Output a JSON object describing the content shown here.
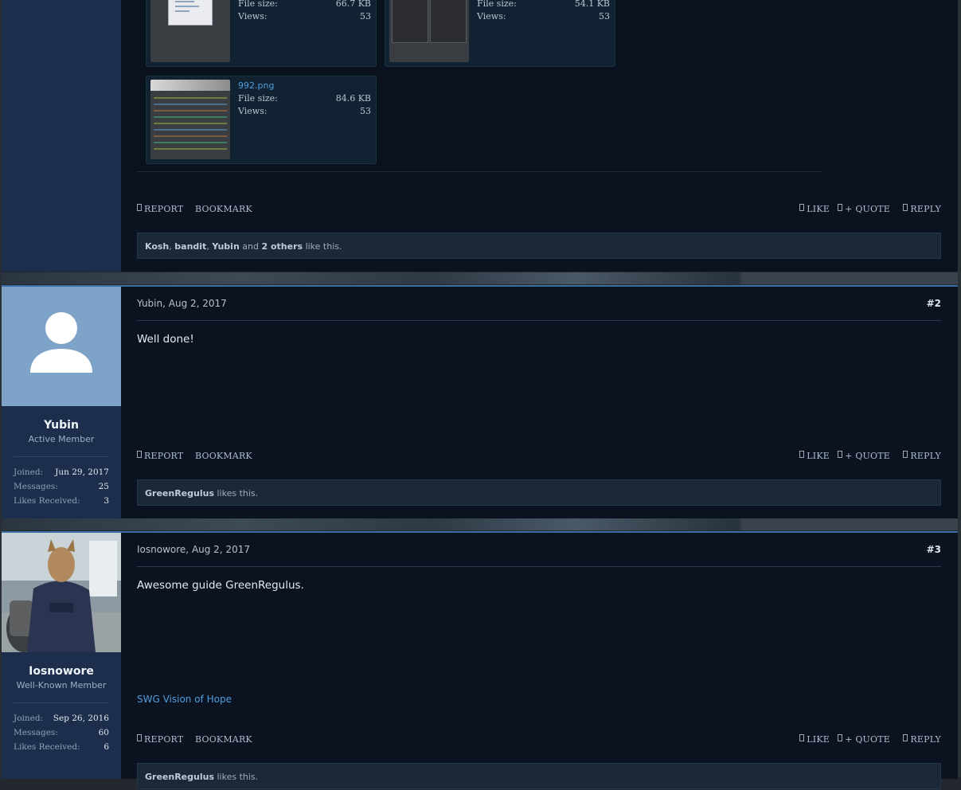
{
  "attachments": [
    {
      "name": "",
      "size_label": "File size:",
      "size": "66.7 KB",
      "views_label": "Views:",
      "views": "53"
    },
    {
      "name": "",
      "size_label": "File size:",
      "size": "54.1 KB",
      "views_label": "Views:",
      "views": "53"
    },
    {
      "name": "992.png",
      "size_label": "File size:",
      "size": "84.6 KB",
      "views_label": "Views:",
      "views": "53"
    }
  ],
  "actions": {
    "report": "REPORT",
    "bookmark": "BOOKMARK",
    "like": "LIKE",
    "quote": "+ QUOTE",
    "reply": "REPLY"
  },
  "posts": [
    {
      "likes": {
        "u1": "Kosh",
        "u2": "bandit",
        "u3": "Yubin",
        "and": "and",
        "others": "2 others",
        "suffix": "like this."
      }
    },
    {
      "author": "Yubin",
      "date": "Aug 2, 2017",
      "number": "#2",
      "body": "Well done!",
      "title": "Active Member",
      "stats": {
        "joined_label": "Joined:",
        "joined": "Jun 29, 2017",
        "messages_label": "Messages:",
        "messages": "25",
        "likes_label": "Likes Received:",
        "likes": "3"
      },
      "likes": {
        "u1": "GreenRegulus",
        "suffix": "likes this."
      }
    },
    {
      "author": "Iosnowore",
      "date": "Aug 2, 2017",
      "number": "#3",
      "body": "Awesome guide GreenRegulus.",
      "signature": "SWG Vision of Hope",
      "title": "Well-Known Member",
      "stats": {
        "joined_label": "Joined:",
        "joined": "Sep 26, 2016",
        "messages_label": "Messages:",
        "messages": "60",
        "likes_label": "Likes Received:",
        "likes": "6"
      },
      "likes": {
        "u1": "GreenRegulus",
        "suffix": "likes this."
      }
    }
  ],
  "colors": {
    "accent": "#3a6ea5",
    "link": "#4f9ddc",
    "user_column": "#1c2e4c",
    "post_bg": "#0c1320"
  },
  "icons": {
    "avatar_default": "user-silhouette-icon"
  }
}
